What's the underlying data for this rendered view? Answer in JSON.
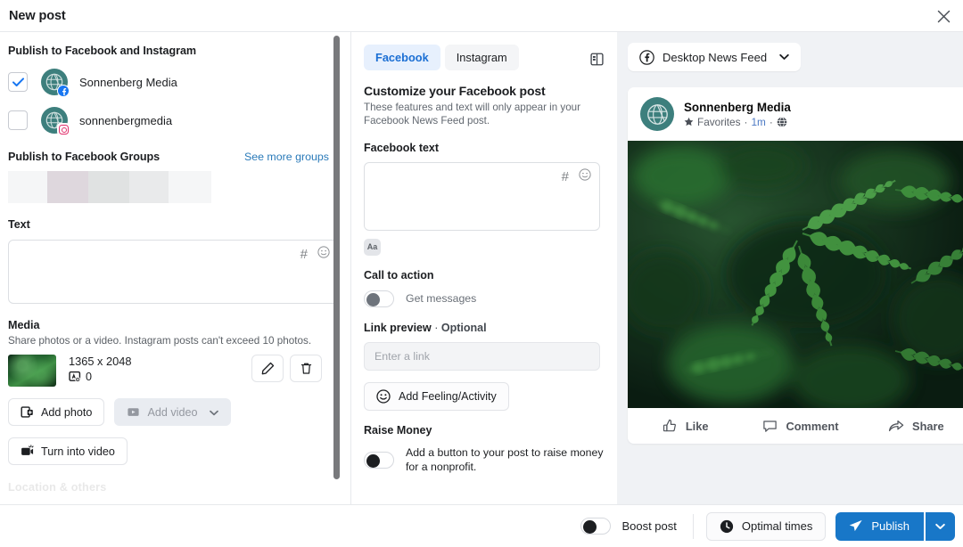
{
  "window": {
    "title": "New post",
    "close_icon": "close-icon"
  },
  "left": {
    "publish_heading": "Publish to Facebook and Instagram",
    "accounts": [
      {
        "name": "Sonnenberg Media",
        "network": "facebook",
        "checked": true
      },
      {
        "name": "sonnenbergmedia",
        "network": "instagram",
        "checked": false
      }
    ],
    "groups_heading": "Publish to Facebook Groups",
    "see_more_groups": "See more groups",
    "text_label": "Text",
    "text_value": "",
    "text_hash_icon": "hashtag-icon",
    "text_emoji_icon": "emoji-icon",
    "media_label": "Media",
    "media_desc": "Share photos or a video. Instagram posts can't exceed 10 photos.",
    "media_dimensions": "1365 x 2048",
    "alt_text_count": "0",
    "edit_icon": "pencil-icon",
    "delete_icon": "trash-icon",
    "add_photo_label": "Add photo",
    "add_video_label": "Add video",
    "turn_into_video_label": "Turn into video",
    "cut_off_label": "Location & others"
  },
  "middle": {
    "tabs": [
      {
        "label": "Facebook",
        "active": true
      },
      {
        "label": "Instagram",
        "active": false
      }
    ],
    "panel_toggle_icon": "split-panel-icon",
    "heading": "Customize your Facebook post",
    "subheading": "These features and text will only appear in your Facebook News Feed post.",
    "fb_text_label": "Facebook text",
    "fb_text_value": "",
    "fb_hash_icon": "hashtag-icon",
    "fb_emoji_icon": "emoji-icon",
    "aa_button_label": "Aa",
    "cta_label": "Call to action",
    "cta_toggle_text": "Get messages",
    "cta_toggle_on": false,
    "link_preview_label": "Link preview",
    "link_preview_optional": "Optional",
    "link_preview_separator": "·",
    "link_placeholder": "Enter a link",
    "link_value": "",
    "feeling_label": "Add Feeling/Activity",
    "feeling_icon": "smiley-icon",
    "raise_money_label": "Raise Money",
    "raise_money_text": "Add a button to your post to raise money for a nonprofit.",
    "raise_money_toggle_on": false
  },
  "right": {
    "feed_selector": "Desktop News Feed",
    "feed_icon": "facebook-icon",
    "feed_caret_icon": "chevron-down-icon",
    "post": {
      "author": "Sonnenberg Media",
      "favorites": "Favorites",
      "favorites_icon": "star-icon",
      "time": "1m",
      "separator": "·",
      "audience_icon": "globe-icon",
      "actions": [
        {
          "label": "Like",
          "icon": "thumbs-up-icon"
        },
        {
          "label": "Comment",
          "icon": "comment-icon"
        },
        {
          "label": "Share",
          "icon": "share-icon"
        }
      ]
    }
  },
  "bottom": {
    "boost_label": "Boost post",
    "boost_toggle_on": false,
    "optimal_times_label": "Optimal times",
    "optimal_times_icon": "clock-icon",
    "publish_label": "Publish",
    "publish_icon": "send-icon",
    "publish_caret_icon": "chevron-down-icon"
  },
  "colors": {
    "accent_blue": "#1877c8",
    "tab_active_bg": "#e7f0fd",
    "tab_active_text": "#1b6fd4",
    "link_blue": "#2a7ab9",
    "avatar_teal": "#3d7f7d",
    "right_panel_bg": "#f0f2f5"
  }
}
